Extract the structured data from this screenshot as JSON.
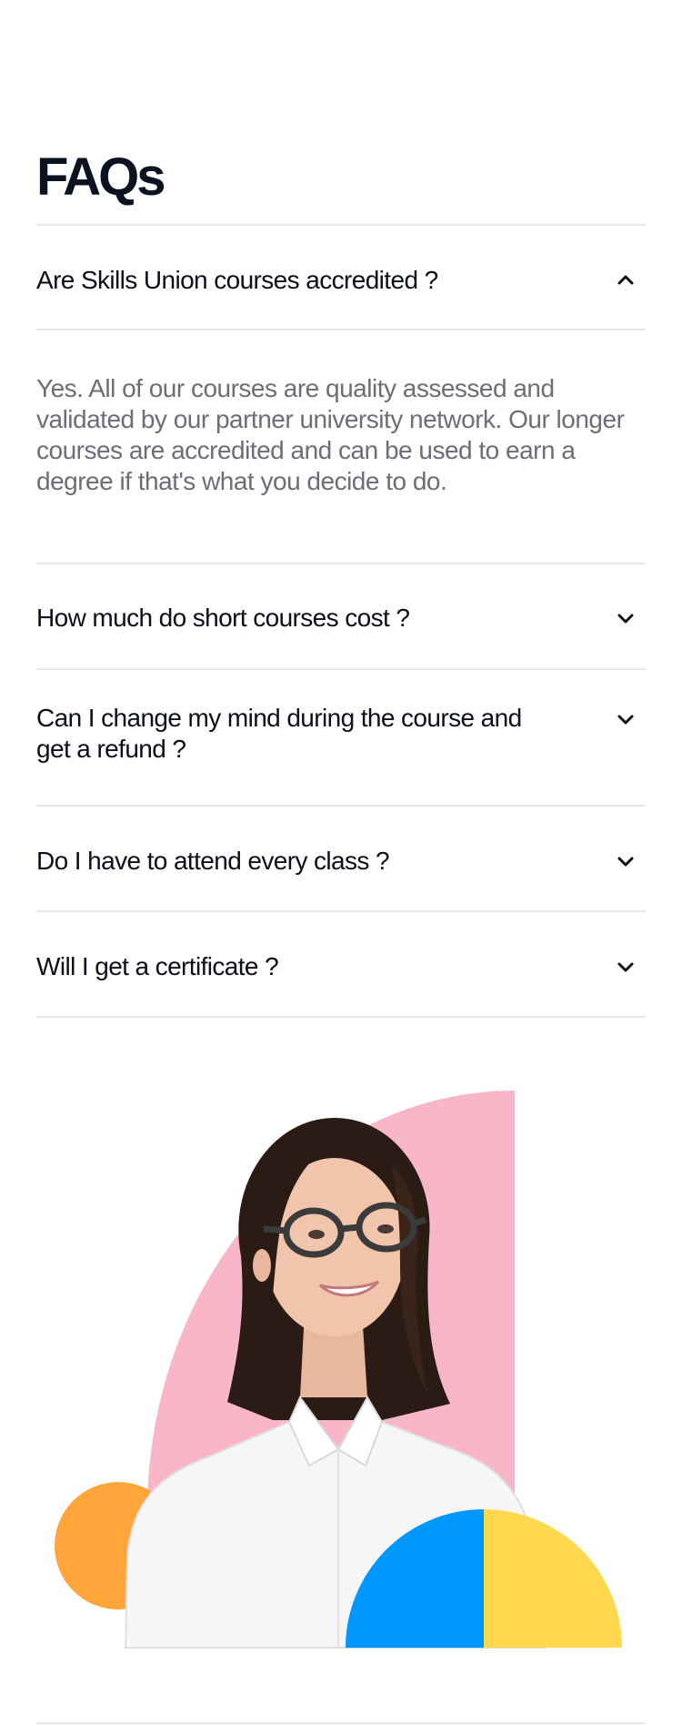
{
  "page": {
    "title": "FAQs"
  },
  "faqs": [
    {
      "question": "Are Skills Union courses accredited ?",
      "expanded": true,
      "answer": "Yes. All of our courses are quality assessed and validated by our partner university network. Our longer courses are accredited and can be used to earn a degree if that's what you decide to do."
    },
    {
      "question": "How much do short courses cost ?",
      "expanded": false
    },
    {
      "question": "Can I change my mind during the course and get a refund ?",
      "expanded": false
    },
    {
      "question": "Do I have to attend every class ?",
      "expanded": false
    },
    {
      "question": "Will I get a certificate ?",
      "expanded": false
    }
  ],
  "icons": {
    "expanded": "chevron-up-icon",
    "collapsed": "chevron-down-icon"
  },
  "colors": {
    "text": "#0b0f1a",
    "answer_text": "#6b6e75",
    "divider": "#e6e7ea",
    "pink": "#f9b6c8",
    "orange": "#ffa53a",
    "blue": "#0097ff",
    "yellow": "#ffd84d"
  }
}
